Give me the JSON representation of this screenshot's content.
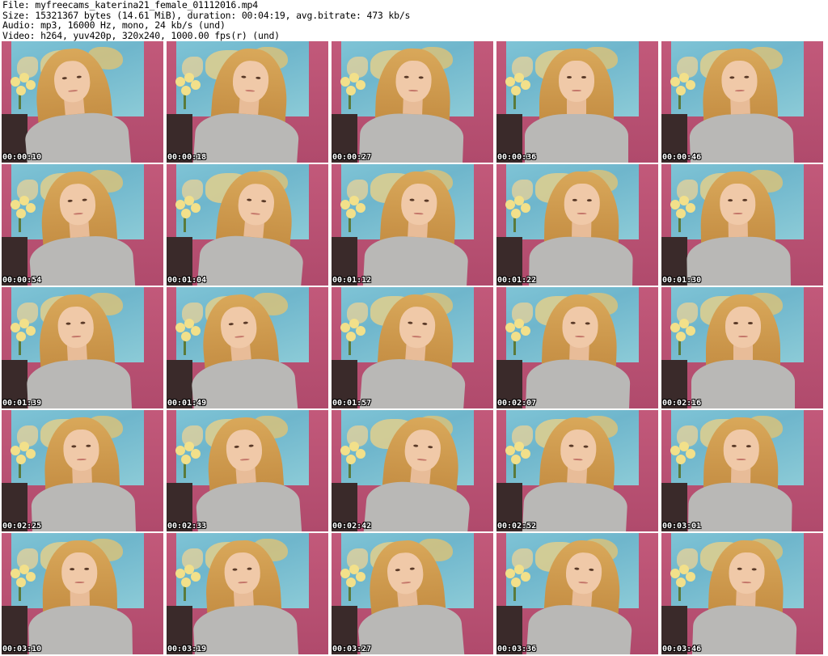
{
  "header": {
    "file": "File: myfreecams_katerina21_female_01112016.mp4",
    "size": "Size: 15321367 bytes (14.61 MiB), duration: 00:04:19, avg.bitrate: 473 kb/s",
    "audio": "Audio: mp3, 16000 Hz, mono, 24 kb/s (und)",
    "video": "Video: h264, yuv420p, 320x240, 1000.00 fps(r) (und)"
  },
  "thumbnails": [
    "00:00:10",
    "00:00:18",
    "00:00:27",
    "00:00:36",
    "00:00:46",
    "00:00:54",
    "00:01:04",
    "00:01:12",
    "00:01:22",
    "00:01:30",
    "00:01:39",
    "00:01:49",
    "00:01:57",
    "00:02:07",
    "00:02:16",
    "00:02:25",
    "00:02:33",
    "00:02:42",
    "00:02:52",
    "00:03:01",
    "00:03:10",
    "00:03:19",
    "00:03:27",
    "00:03:36",
    "00:03:46"
  ],
  "colors": {
    "background": "#ffffff",
    "wall": "#c2597a",
    "map": "#7fc4d6",
    "hair": "#c89247",
    "sweater": "#b9b8b6",
    "timestamp_text": "#ffffff"
  }
}
